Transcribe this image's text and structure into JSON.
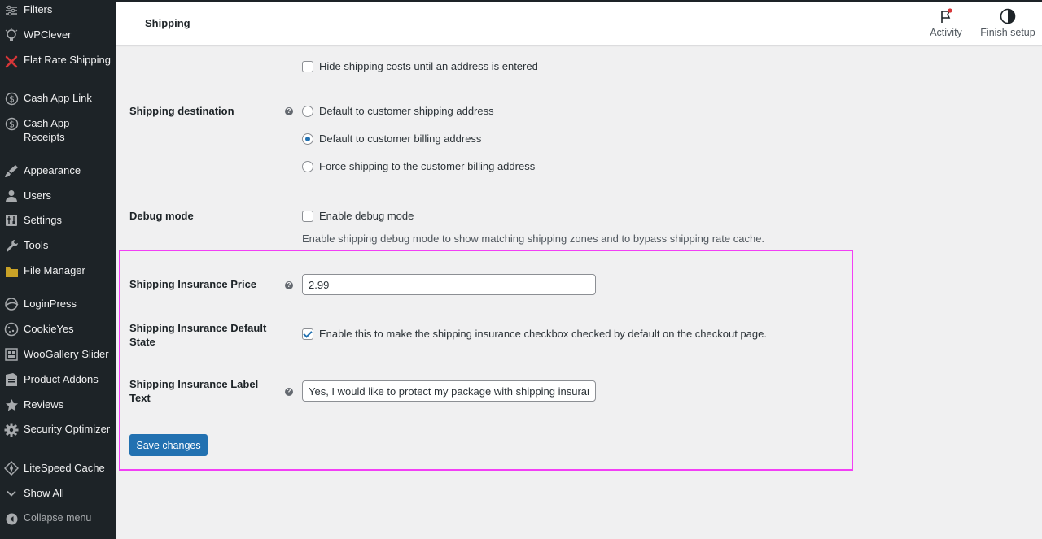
{
  "sidebar": {
    "items": [
      {
        "label": "Filters",
        "icon": "filters-icon"
      },
      {
        "label": "WPClever",
        "icon": "wpclever-icon"
      },
      {
        "label": "Flat Rate Shipping",
        "icon": "flat-rate-icon"
      },
      {
        "label": "Cash App Link",
        "icon": "dollar-icon"
      },
      {
        "label": "Cash App Receipts",
        "icon": "dollar-icon"
      },
      {
        "label": "Appearance",
        "icon": "paintbrush-icon"
      },
      {
        "label": "Users",
        "icon": "users-icon"
      },
      {
        "label": "Settings",
        "icon": "settings-icon"
      },
      {
        "label": "Tools",
        "icon": "wrench-icon"
      },
      {
        "label": "File Manager",
        "icon": "folder-icon"
      },
      {
        "label": "LoginPress",
        "icon": "loginpress-icon"
      },
      {
        "label": "CookieYes",
        "icon": "cookie-icon"
      },
      {
        "label": "WooGallery Slider",
        "icon": "gallery-icon"
      },
      {
        "label": "Product Addons",
        "icon": "addons-icon"
      },
      {
        "label": "Reviews",
        "icon": "star-icon"
      },
      {
        "label": "Security Optimizer",
        "icon": "gear-icon"
      },
      {
        "label": "LiteSpeed Cache",
        "icon": "diamond-icon"
      },
      {
        "label": "Show All",
        "icon": "chevron-down-icon"
      }
    ],
    "collapse_label": "Collapse menu"
  },
  "header": {
    "title": "Shipping",
    "activity_label": "Activity",
    "finish_setup_label": "Finish setup"
  },
  "settings": {
    "hide_costs_label": "Hide shipping costs until an address is entered",
    "shipping_destination": {
      "label": "Shipping destination",
      "options": [
        "Default to customer shipping address",
        "Default to customer billing address",
        "Force shipping to the customer billing address"
      ],
      "selected_index": 1
    },
    "debug_mode": {
      "label": "Debug mode",
      "checkbox_label": "Enable debug mode",
      "description": "Enable shipping debug mode to show matching shipping zones and to bypass shipping rate cache."
    },
    "insurance_price": {
      "label": "Shipping Insurance Price",
      "value": "2.99"
    },
    "insurance_default_state": {
      "label": "Shipping Insurance Default State",
      "checkbox_label": "Enable this to make the shipping insurance checkbox checked by default on the checkout page.",
      "checked": true
    },
    "insurance_label_text": {
      "label": "Shipping Insurance Label Text",
      "value": "Yes, I would like to protect my package with shipping insurance"
    },
    "save_label": "Save changes"
  },
  "colors": {
    "sidebar_bg": "#1d2327",
    "accent": "#2271b1",
    "highlight": "#f23ff5",
    "notification": "#d63638"
  }
}
